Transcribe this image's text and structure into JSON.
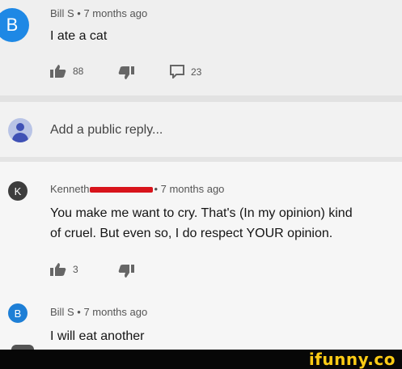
{
  "comment": {
    "avatar_letter": "B",
    "author": "Bill S",
    "separator": "•",
    "time": "7 months ago",
    "text": "I ate a cat",
    "likes": "88",
    "replies": "23"
  },
  "reply_box": {
    "placeholder": "Add a public reply..."
  },
  "reply1": {
    "avatar_letter": "K",
    "author": "Kenneth",
    "separator": "•",
    "time": "7 months ago",
    "text_line1": "You make me want to cry. That's (In my opinion) kind",
    "text_line2": "of cruel. But even so, I do respect YOUR opinion.",
    "likes": "3"
  },
  "reply2": {
    "avatar_letter": "B",
    "author": "Bill S",
    "separator": "•",
    "time": "7 months ago",
    "text": "I will eat another"
  },
  "watermark": {
    "text": "ifunny.co"
  },
  "colors": {
    "avatar_bill": "#1e88e5",
    "avatar_kenneth": "#3d3d3d",
    "redaction": "#d8141b",
    "watermark": "#fccb15"
  }
}
